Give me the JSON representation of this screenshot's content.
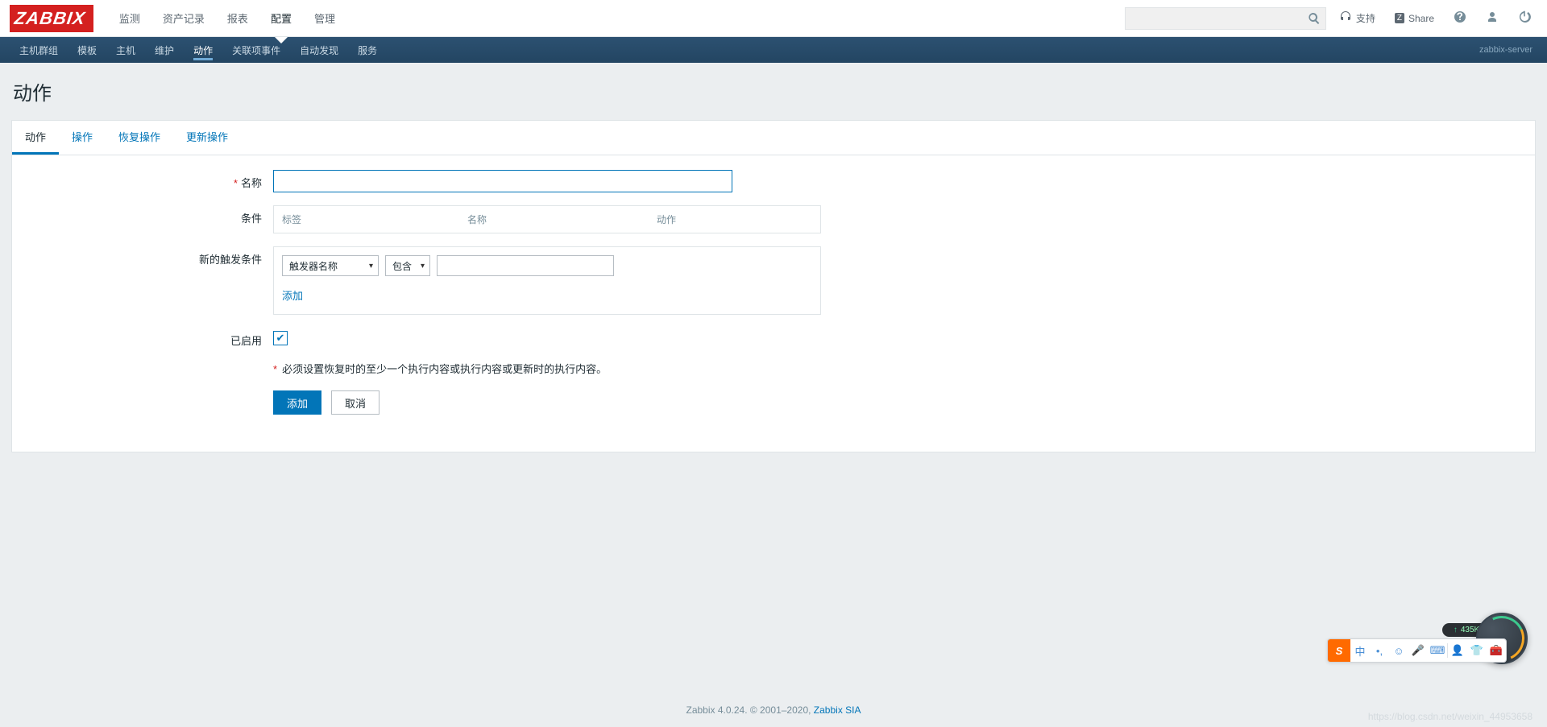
{
  "brand": "ZABBIX",
  "mainNav": {
    "items": [
      "监测",
      "资产记录",
      "报表",
      "配置",
      "管理"
    ],
    "activeIndex": 3
  },
  "headerRight": {
    "support": "支持",
    "share": "Share"
  },
  "subNav": {
    "items": [
      "主机群组",
      "模板",
      "主机",
      "维护",
      "动作",
      "关联项事件",
      "自动发现",
      "服务"
    ],
    "activeIndex": 4,
    "serverName": "zabbix-server"
  },
  "page": {
    "title": "动作"
  },
  "tabs": {
    "items": [
      "动作",
      "操作",
      "恢复操作",
      "更新操作"
    ],
    "activeIndex": 0
  },
  "form": {
    "nameLabel": "名称",
    "nameValue": "",
    "conditionLabel": "条件",
    "condHeaders": [
      "标签",
      "名称",
      "动作"
    ],
    "newTriggerLabel": "新的触发条件",
    "triggerSelect": "触发器名称",
    "operatorSelect": "包含",
    "triggerValue": "",
    "addLink": "添加",
    "enabledLabel": "已启用",
    "enabledChecked": true,
    "warning": "必须设置恢复时的至少一个执行内容或执行内容或更新时的执行内容。",
    "submitBtn": "添加",
    "cancelBtn": "取消"
  },
  "footer": {
    "text": "Zabbix 4.0.24. © 2001–2020, ",
    "link": "Zabbix SIA"
  },
  "watermark": "https://blog.csdn.net/weixin_44953658",
  "ime": {
    "lang": "中",
    "speed": "435K/s"
  }
}
